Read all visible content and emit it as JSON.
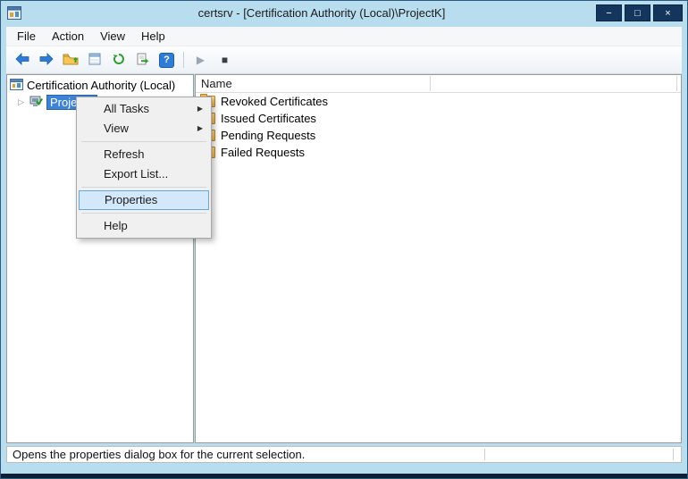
{
  "window": {
    "title": "certsrv - [Certification Authority (Local)\\ProjectK]",
    "caption_buttons": {
      "minimize": "−",
      "maximize": "□",
      "close": "×"
    }
  },
  "menu": {
    "items": [
      "File",
      "Action",
      "View",
      "Help"
    ]
  },
  "toolbar": {
    "buttons": [
      "back-icon",
      "forward-icon",
      "folder-up-icon",
      "window-list-icon",
      "refresh-icon",
      "export-list-icon",
      "help-icon",
      "play-icon",
      "stop-icon"
    ]
  },
  "tree": {
    "root_label": "Certification Authority (Local)",
    "child_label": "ProjectK",
    "collapsed_glyph": "▷"
  },
  "list": {
    "header": "Name",
    "items": [
      "Revoked Certificates",
      "Issued Certificates",
      "Pending Requests",
      "Failed Requests"
    ]
  },
  "context_menu": {
    "submenu_glyph": "▶",
    "all_tasks": "All Tasks",
    "view": "View",
    "refresh": "Refresh",
    "export_list": "Export List...",
    "properties": "Properties",
    "help": "Help"
  },
  "status_bar": {
    "text": "Opens the properties dialog box for the current selection."
  },
  "colors": {
    "titlebar": "#b7ddef",
    "caption_button": "#15365c",
    "tree_selection": "#3e82d6",
    "menu_highlight_bg": "#d3e9fb",
    "menu_highlight_border": "#66a7d8"
  }
}
